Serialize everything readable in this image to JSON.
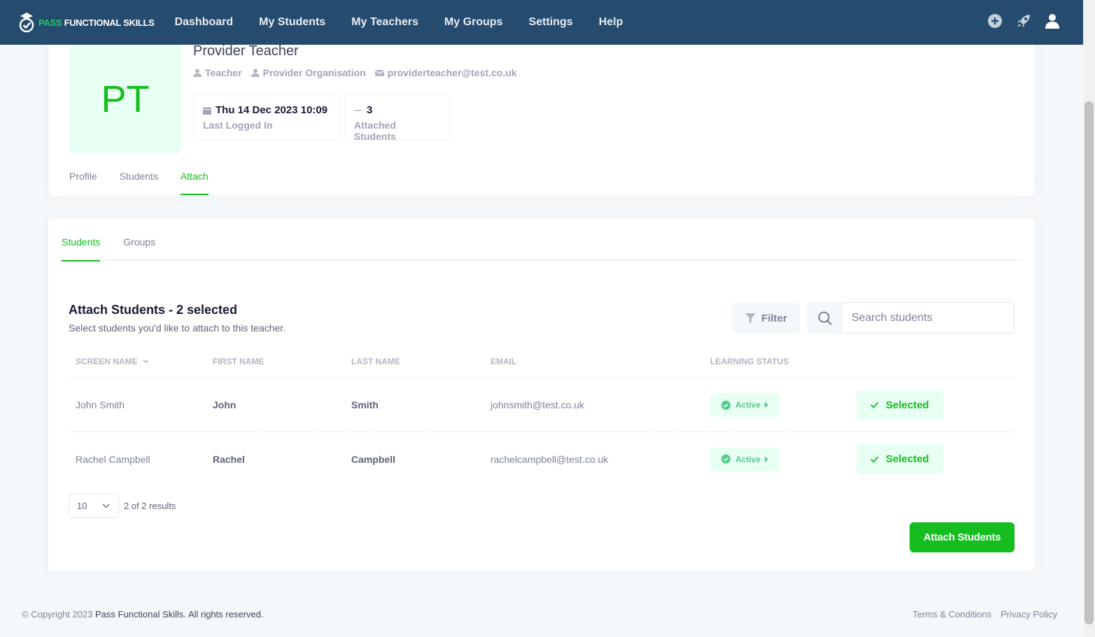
{
  "app": {
    "logo_pass": "PASS",
    "logo_rest": "FUNCTIONAL SKILLS",
    "nav": [
      "Dashboard",
      "My Students",
      "My Teachers",
      "My Groups",
      "Settings",
      "Help"
    ],
    "icons": [
      "plus-circle-icon",
      "rocket-icon",
      "user-icon"
    ]
  },
  "teacher": {
    "initials": "PT",
    "name": "Provider Teacher",
    "role": "Teacher",
    "organisation": "Provider Organisation",
    "email": "providerteacher@test.co.uk",
    "last_logged_in_value": "Thu 14 Dec 2023 10:09",
    "last_logged_in_label": "Last Logged In",
    "attached_count": "3",
    "attached_label": "Attached Students"
  },
  "header_tabs": [
    "Profile",
    "Students",
    "Attach"
  ],
  "sub_tabs": [
    "Students",
    "Groups"
  ],
  "attach": {
    "title": "Attach Students - 2 selected",
    "subtitle": "Select students you'd like to attach to this teacher.",
    "filter_label": "Filter",
    "search_placeholder": "Search students",
    "columns": [
      "Screen Name",
      "First Name",
      "Last Name",
      "Email",
      "Learning Status"
    ],
    "rows": [
      {
        "screen_name": "John Smith",
        "first_name": "John",
        "last_name": "Smith",
        "email": "johnsmith@test.co.uk",
        "status": "Active",
        "action": "Selected"
      },
      {
        "screen_name": "Rachel Campbell",
        "first_name": "Rachel",
        "last_name": "Campbell",
        "email": "rachelcampbell@test.co.uk",
        "status": "Active",
        "action": "Selected"
      }
    ],
    "page_size": "10",
    "results_text": "2 of 2 results",
    "attach_button": "Attach Students"
  },
  "footer": {
    "copyright_prefix": "© Copyright 2023 ",
    "brand": "Pass Functional Skills",
    "suffix": ". All rights reserved.",
    "links": [
      "Terms & Conditions",
      "Privacy Policy"
    ]
  },
  "colors": {
    "navbar": "#254b6e",
    "accent": "#15bd1e",
    "accent_light": "#e8fff3"
  }
}
